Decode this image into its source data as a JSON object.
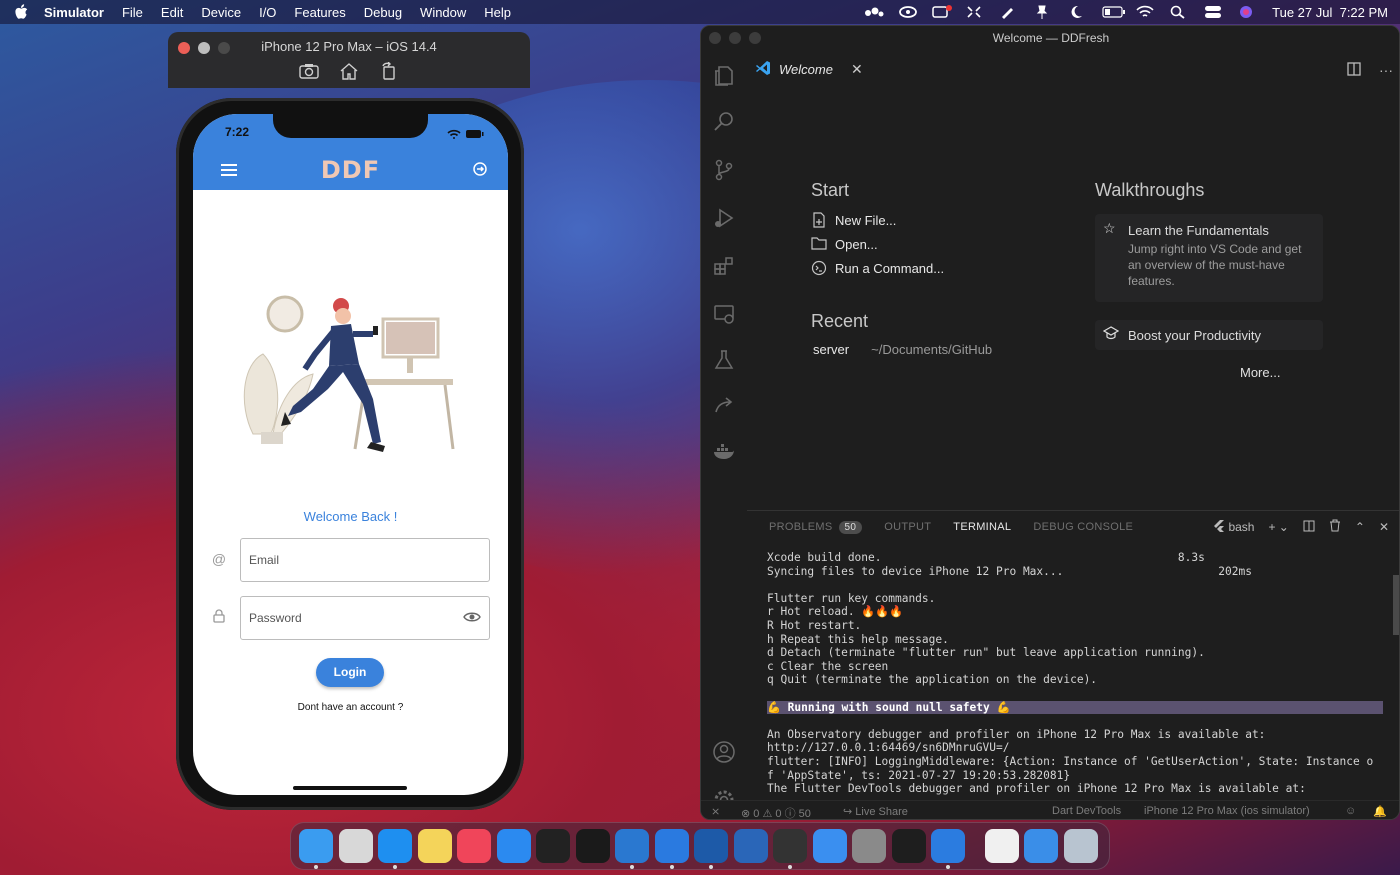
{
  "menubar": {
    "app_name": "Simulator",
    "items": [
      "File",
      "Edit",
      "Device",
      "I/O",
      "Features",
      "Debug",
      "Window",
      "Help"
    ],
    "clock": "Tue 27 Jul  7:22 PM"
  },
  "simulator": {
    "title": "iPhone 12 Pro Max – iOS 14.4",
    "tools": [
      "camera-icon",
      "home-icon",
      "rotate-icon"
    ]
  },
  "app": {
    "status_time": "7:22",
    "logo": "DDF",
    "welcome": "Welcome Back !",
    "email_placeholder": "Email",
    "password_placeholder": "Password",
    "login_label": "Login",
    "signup_text": "Dont have an account ?",
    "accent": "#3a82dc"
  },
  "vscode": {
    "title": "Welcome — DDFresh",
    "tab": "Welcome",
    "start_heading": "Start",
    "start_items": [
      "New File...",
      "Open...",
      "Run a Command..."
    ],
    "recent_heading": "Recent",
    "recent_items": [
      {
        "name": "server",
        "path": "~/Documents/GitHub"
      }
    ],
    "walkthroughs_heading": "Walkthroughs",
    "walkthroughs": [
      {
        "title": "Learn the Fundamentals",
        "desc": "Jump right into VS Code and get an overview of the must-have features."
      },
      {
        "title": "Boost your Productivity",
        "desc": ""
      }
    ],
    "more_label": "More...",
    "panel_tabs": [
      "PROBLEMS",
      "OUTPUT",
      "TERMINAL",
      "DEBUG CONSOLE"
    ],
    "problems_count": "50",
    "shell_label": "bash",
    "terminal_lines": [
      "Xcode build done.                                            8.3s",
      "Syncing files to device iPhone 12 Pro Max...                       202ms",
      "",
      "Flutter run key commands.",
      "r Hot reload. 🔥🔥🔥",
      "R Hot restart.",
      "h Repeat this help message.",
      "d Detach (terminate \"flutter run\" but leave application running).",
      "c Clear the screen",
      "q Quit (terminate the application on the device).",
      "",
      "💪 Running with sound null safety 💪",
      "",
      "An Observatory debugger and profiler on iPhone 12 Pro Max is available at:",
      "http://127.0.0.1:64469/sn6DMnruGVU=/",
      "flutter: [INFO] LoggingMiddleware: {Action: Instance of 'GetUserAction', State: Instance o",
      "f 'AppState', ts: 2021-07-27 19:20:53.282081}",
      "The Flutter DevTools debugger and profiler on iPhone 12 Pro Max is available at:"
    ],
    "status": {
      "errors": "0",
      "warnings": "0",
      "infos": "50",
      "live_share": "Live Share",
      "devtools": "Dart DevTools",
      "device": "iPhone 12 Pro Max (ios simulator)"
    }
  },
  "dock": {
    "icons": [
      "finder-icon",
      "launchpad-icon",
      "safari-icon",
      "notes-icon",
      "music-icon",
      "app-store-icon",
      "terminal-icon",
      "activity-monitor-icon",
      "xcode-icon",
      "vscode-icon",
      "sourcetree-icon",
      "r-icon",
      "claquette-icon",
      "mail-icon",
      "system-preferences-icon",
      "figma-icon",
      "simulator-icon",
      "profile-photo-icon",
      "downloads-folder-icon",
      "trash-icon"
    ],
    "colors": [
      "#3a9cf0",
      "#d8d8d8",
      "#1e8ff0",
      "#f4d45a",
      "#f0455a",
      "#2b8af0",
      "#222222",
      "#1a1a1a",
      "#2a78d0",
      "#2a7ae0",
      "#1d5aa8",
      "#2a66b8",
      "#333333",
      "#3a8ff0",
      "#8a8a8a",
      "#1e1e1e",
      "#2b7ce0",
      "#f0f0f0",
      "#3a8ee8",
      "#b8c4d0"
    ]
  }
}
